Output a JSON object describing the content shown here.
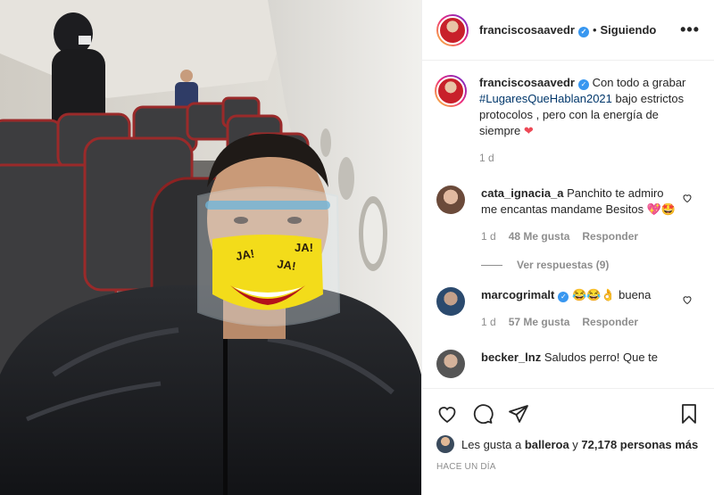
{
  "post": {
    "author": "franciscosaavedr",
    "follow_status": "Siguiendo",
    "separator": "•",
    "more_label": "•••",
    "caption_text_a": "Con todo a grabar ",
    "caption_hashtag": "#LugaresQueHablan2021",
    "caption_text_b": " bajo estrictos protocolos , pero con la energía de siempre ",
    "caption_time": "1 d",
    "photo_mask_text": "JA!"
  },
  "comments": [
    {
      "user": "cata_ignacia_a",
      "text": "Panchito te admiro me encantas mandame Besitos 💖🤩",
      "time": "1 d",
      "likes": "48 Me gusta",
      "reply": "Responder",
      "view_replies": "Ver respuestas (9)"
    },
    {
      "user": "marcogrimalt",
      "text": "😂😂👌 buena",
      "time": "1 d",
      "likes": "57 Me gusta",
      "reply": "Responder"
    },
    {
      "user": "becker_lnz",
      "text": "Saludos perro! Que te"
    }
  ],
  "footer": {
    "likes_prefix": "Les gusta a ",
    "likes_user": "balleroa",
    "likes_mid": " y ",
    "likes_count": "72,178 personas más",
    "date": "HACE UN DÍA"
  },
  "colors": {
    "heart": "#ed4956",
    "verified": "#3897f0",
    "link": "#00376b",
    "muted": "#8e8e8e"
  },
  "icons": [
    "heart-icon",
    "comment-icon",
    "share-icon",
    "bookmark-icon",
    "more-icon",
    "verified-icon"
  ]
}
